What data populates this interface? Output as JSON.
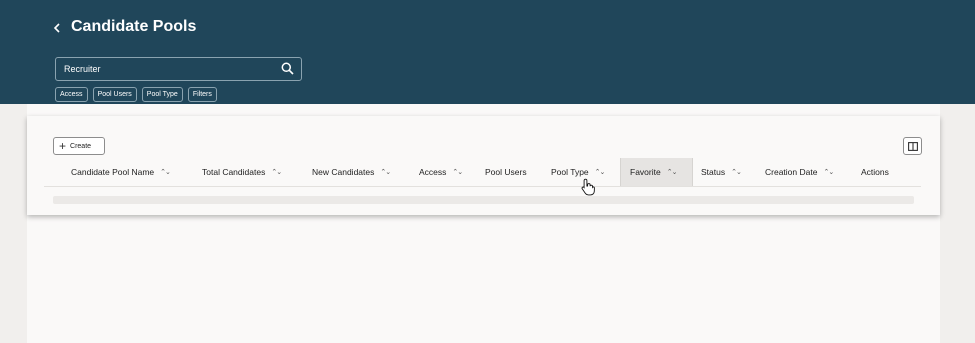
{
  "header": {
    "title": "Candidate Pools",
    "back_icon": "chevron-left-icon",
    "bg_color": "#20465a"
  },
  "search": {
    "value": "Recruiter",
    "icon": "search-icon"
  },
  "filters": {
    "chips": [
      "Access",
      "Pool Users",
      "Pool Type",
      "Filters"
    ]
  },
  "toolbar": {
    "create_label": "Create",
    "create_icon": "plus-icon",
    "panel_icon": "split-panel-icon"
  },
  "table": {
    "columns": [
      {
        "label": "Candidate Pool Name",
        "sortable": true
      },
      {
        "label": "Total Candidates",
        "sortable": true
      },
      {
        "label": "New Candidates",
        "sortable": true
      },
      {
        "label": "Access",
        "sortable": true
      },
      {
        "label": "Pool Users",
        "sortable": false
      },
      {
        "label": "Pool Type",
        "sortable": true
      },
      {
        "label": "Favorite",
        "sortable": true,
        "highlighted": true
      },
      {
        "label": "Status",
        "sortable": true
      },
      {
        "label": "Creation Date",
        "sortable": true
      },
      {
        "label": "Actions",
        "sortable": false
      }
    ]
  }
}
